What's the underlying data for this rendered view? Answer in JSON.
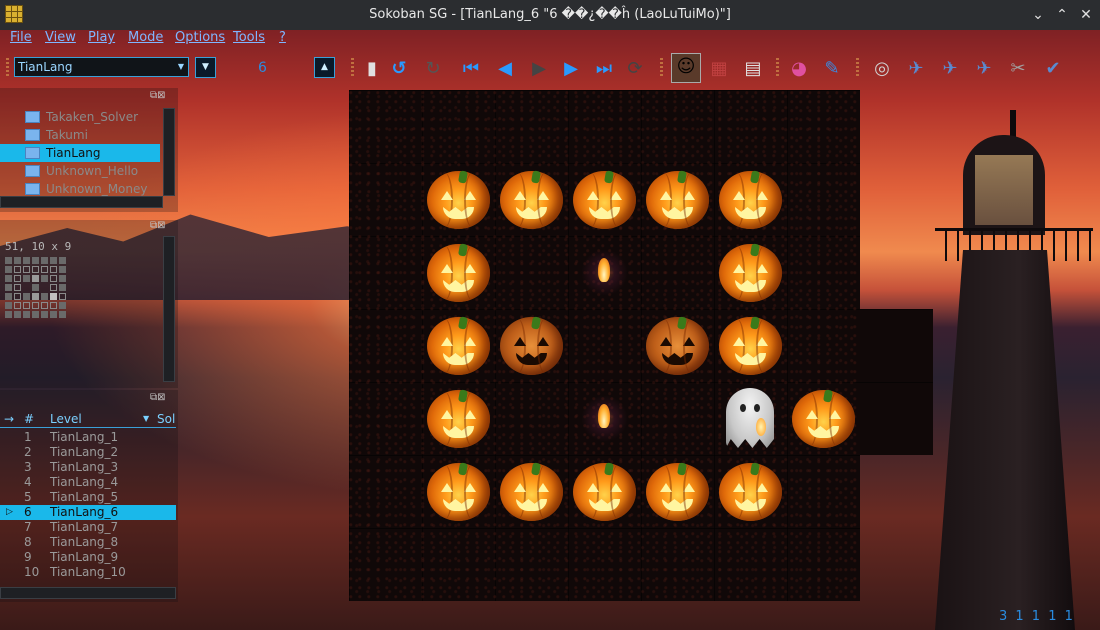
{
  "window": {
    "title": "Sokoban SG - [TianLang_6 \"6 ��¿��ĥ (LaoLuTuiMo)\"]",
    "buttons": [
      "⌄",
      "⌃",
      "✕"
    ]
  },
  "menu": [
    "File",
    "View",
    "Play",
    "Mode",
    "Options",
    "Tools",
    "?"
  ],
  "toolbar": {
    "collection": "TianLang",
    "level_number": "6"
  },
  "folders": {
    "items": [
      "Takaken_Solver",
      "Takumi",
      "TianLang",
      "Unknown_Hello",
      "Unknown_Money"
    ],
    "selected_index": 2
  },
  "preview": {
    "size_text": "51, 10 x 9"
  },
  "levels": {
    "headers": {
      "arrow": "→",
      "num": "#",
      "level": "Level",
      "sol": "Sol"
    },
    "rows": [
      {
        "n": "1",
        "name": "TianLang_1"
      },
      {
        "n": "2",
        "name": "TianLang_2"
      },
      {
        "n": "3",
        "name": "TianLang_3"
      },
      {
        "n": "4",
        "name": "TianLang_4"
      },
      {
        "n": "5",
        "name": "TianLang_5"
      },
      {
        "n": "6",
        "name": "TianLang_6"
      },
      {
        "n": "7",
        "name": "TianLang_7"
      },
      {
        "n": "8",
        "name": "TianLang_8"
      },
      {
        "n": "9",
        "name": "TianLang_9"
      },
      {
        "n": "10",
        "name": "TianLang_10"
      }
    ],
    "selected_index": 5
  },
  "board": {
    "cols": 7,
    "rows": 7,
    "cells": [
      ".......",
      ".PPPPP.",
      ".P.D.P.",
      ".PC.CP.",
      ".P.D.GP",
      ".PPPPP.",
      "......."
    ]
  },
  "status_text": "3 1 1 1 1"
}
